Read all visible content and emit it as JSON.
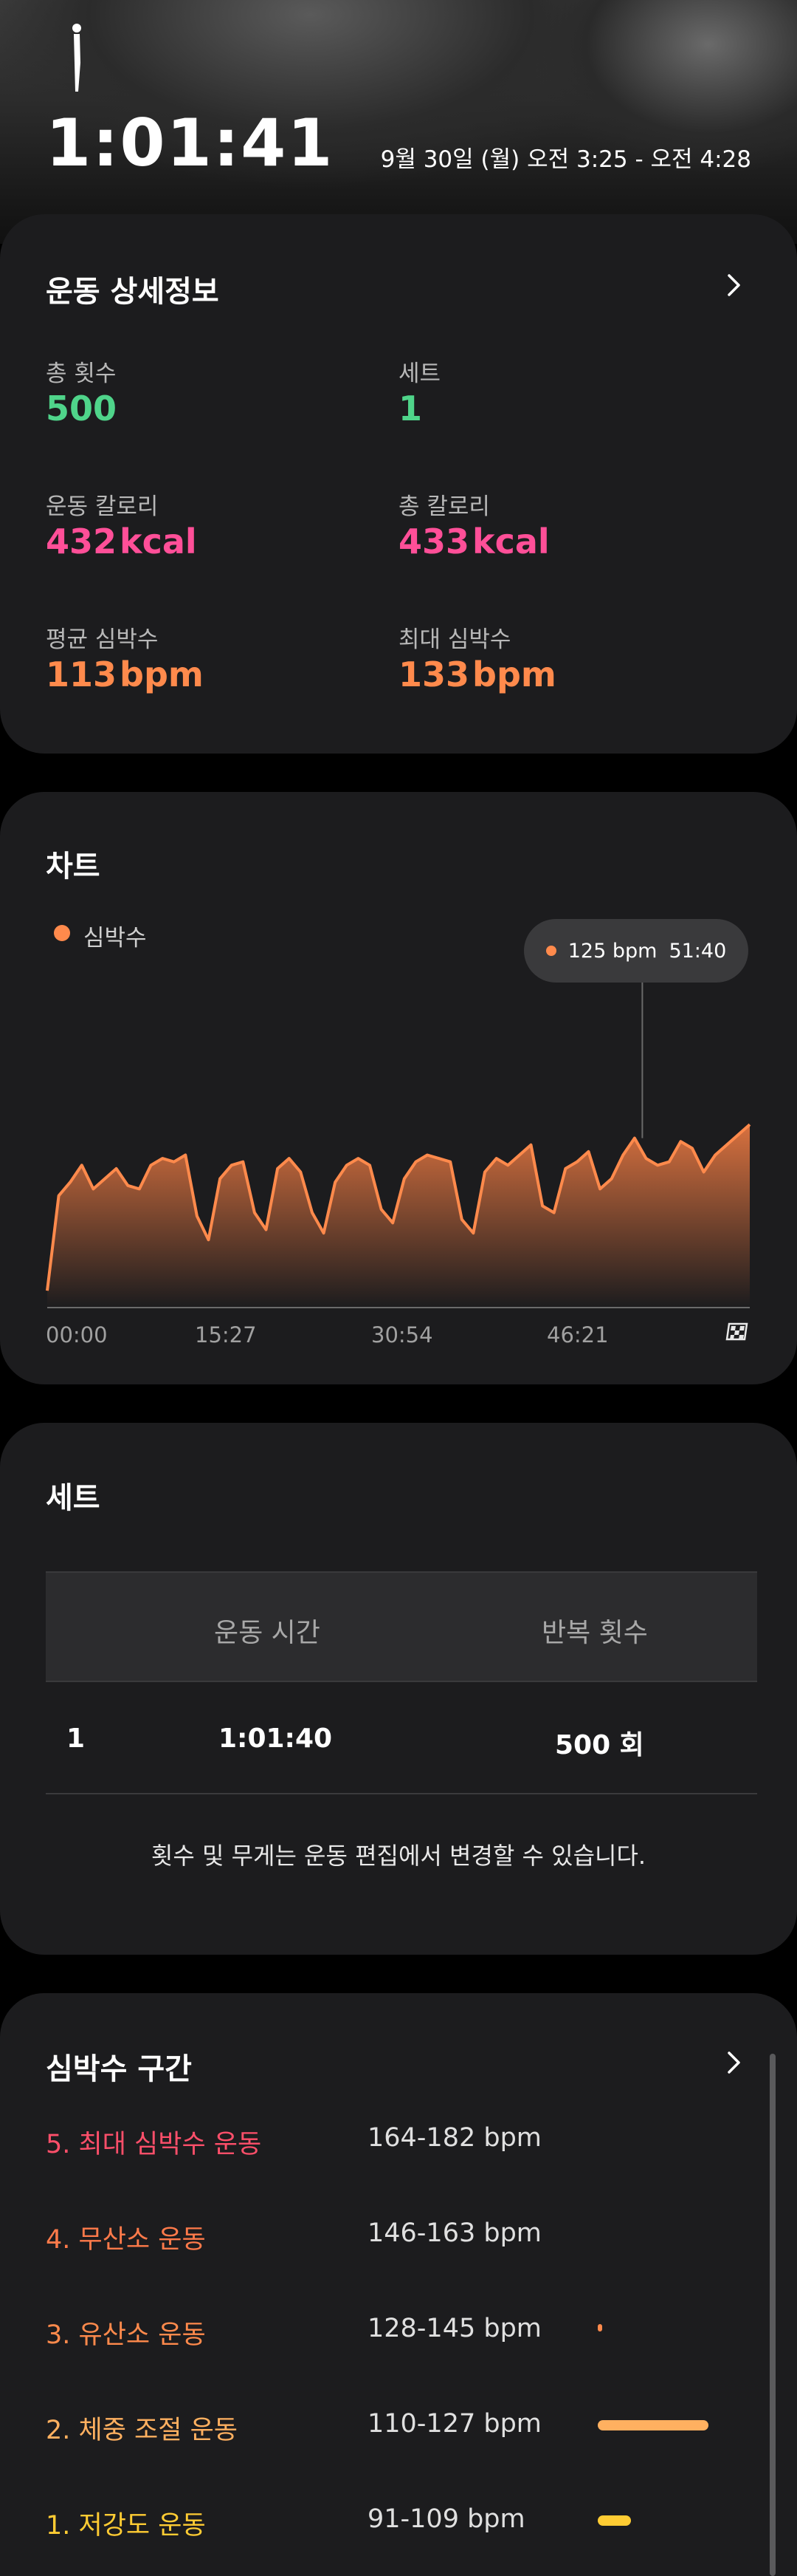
{
  "header": {
    "duration": "1:01:41",
    "date_range": "9월 30일 (월) 오전 3:25 - 오전 4:28"
  },
  "details": {
    "title": "운동 상세정보",
    "total_reps": {
      "label": "총 횟수",
      "value": "500"
    },
    "sets": {
      "label": "세트",
      "value": "1"
    },
    "workout_calories": {
      "label": "운동 칼로리",
      "value": "432",
      "unit": "kcal"
    },
    "total_calories": {
      "label": "총 칼로리",
      "value": "433",
      "unit": "kcal"
    },
    "avg_hr": {
      "label": "평균 심박수",
      "value": "113",
      "unit": "bpm"
    },
    "max_hr": {
      "label": "최대 심박수",
      "value": "133",
      "unit": "bpm"
    },
    "colors": {
      "reps": "#4fd48a",
      "calories": "#ff4f98",
      "heart": "#ff8a4c"
    }
  },
  "chart": {
    "title": "차트",
    "legend": "심박수",
    "tooltip_value": "125 bpm",
    "tooltip_time": "51:40",
    "end_icon": "finish-flag-icon"
  },
  "chart_data": {
    "type": "area",
    "title": "차트",
    "series": [
      {
        "name": "심박수",
        "color": "#ff8a4c"
      }
    ],
    "x_tick_labels": [
      "00:00",
      "15:27",
      "30:54",
      "46:21"
    ],
    "x_minutes": [
      0,
      1,
      2,
      3,
      4,
      5,
      6,
      7,
      8,
      9,
      10,
      11,
      12,
      13,
      14,
      15,
      16,
      17,
      18,
      19,
      20,
      21,
      22,
      23,
      24,
      25,
      26,
      27,
      28,
      29,
      30,
      31,
      32,
      33,
      34,
      35,
      36,
      37,
      38,
      39,
      40,
      41,
      42,
      43,
      44,
      45,
      46,
      47,
      48,
      49,
      50,
      51,
      52,
      53,
      54,
      55,
      56,
      57,
      58,
      59,
      60,
      61
    ],
    "y_bpm": [
      80,
      108,
      112,
      117,
      110,
      113,
      116,
      111,
      110,
      117,
      119,
      118,
      120,
      102,
      95,
      113,
      117,
      118,
      103,
      98,
      116,
      119,
      115,
      103,
      97,
      112,
      117,
      119,
      117,
      104,
      100,
      113,
      118,
      120,
      119,
      118,
      101,
      97,
      115,
      119,
      117,
      120,
      123,
      105,
      103,
      116,
      118,
      121,
      110,
      113,
      120,
      125,
      119,
      117,
      118,
      124,
      122,
      115,
      120,
      123,
      126,
      129
    ],
    "ylim": [
      75,
      160
    ],
    "highlight": {
      "x_minutes": 51.67,
      "y_bpm": 125
    }
  },
  "sets_section": {
    "title": "세트",
    "columns": [
      "운동 시간",
      "반복 횟수"
    ],
    "rows": [
      {
        "index": "1",
        "time": "1:01:40",
        "reps": "500 회"
      }
    ],
    "note": "횟수 및 무게는 운동 편집에서 변경할 수 있습니다."
  },
  "zones": {
    "title": "심박수 구간",
    "items": [
      {
        "label": "5. 최대 심박수 운동",
        "range": "164-182 bpm",
        "color": "#ff4f6a",
        "share": 0
      },
      {
        "label": "4. 무산소 운동",
        "range": "146-163 bpm",
        "color": "#ff7a4a",
        "share": 0
      },
      {
        "label": "3. 유산소 운동",
        "range": "128-145 bpm",
        "color": "#ff8a4c",
        "share": 0.02
      },
      {
        "label": "2. 체중 조절 운동",
        "range": "110-127 bpm",
        "color": "#ffb060",
        "share": 0.5
      },
      {
        "label": "1. 저강도 운동",
        "range": "91-109 bpm",
        "color": "#ffcc33",
        "share": 0.15
      }
    ]
  }
}
